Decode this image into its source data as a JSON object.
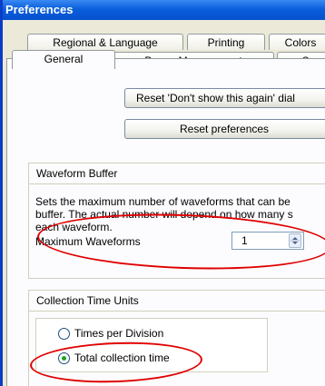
{
  "window": {
    "title": "Preferences"
  },
  "tabs_row1": [
    {
      "label": "Regional & Language"
    },
    {
      "label": "Printing"
    },
    {
      "label": "Colors"
    }
  ],
  "tabs_row2": [
    {
      "label": "General",
      "active": true
    },
    {
      "label": "Power Management"
    },
    {
      "label": "Sa"
    }
  ],
  "buttons": {
    "reset_dont_show": "Reset 'Don't show this again' dial",
    "reset_preferences": "Reset preferences"
  },
  "waveform_buffer": {
    "title": "Waveform Buffer",
    "description_lines": [
      "Sets the maximum number of waveforms that can be",
      "buffer. The actual number will depend on how many s",
      "each waveform."
    ],
    "max_label": "Maximum Waveforms",
    "max_value": "1"
  },
  "collection_time_units": {
    "title": "Collection Time Units",
    "options": [
      {
        "label": "Times per Division",
        "checked": false
      },
      {
        "label": "Total collection time",
        "checked": true
      }
    ]
  },
  "annotation_color": "#e00000"
}
